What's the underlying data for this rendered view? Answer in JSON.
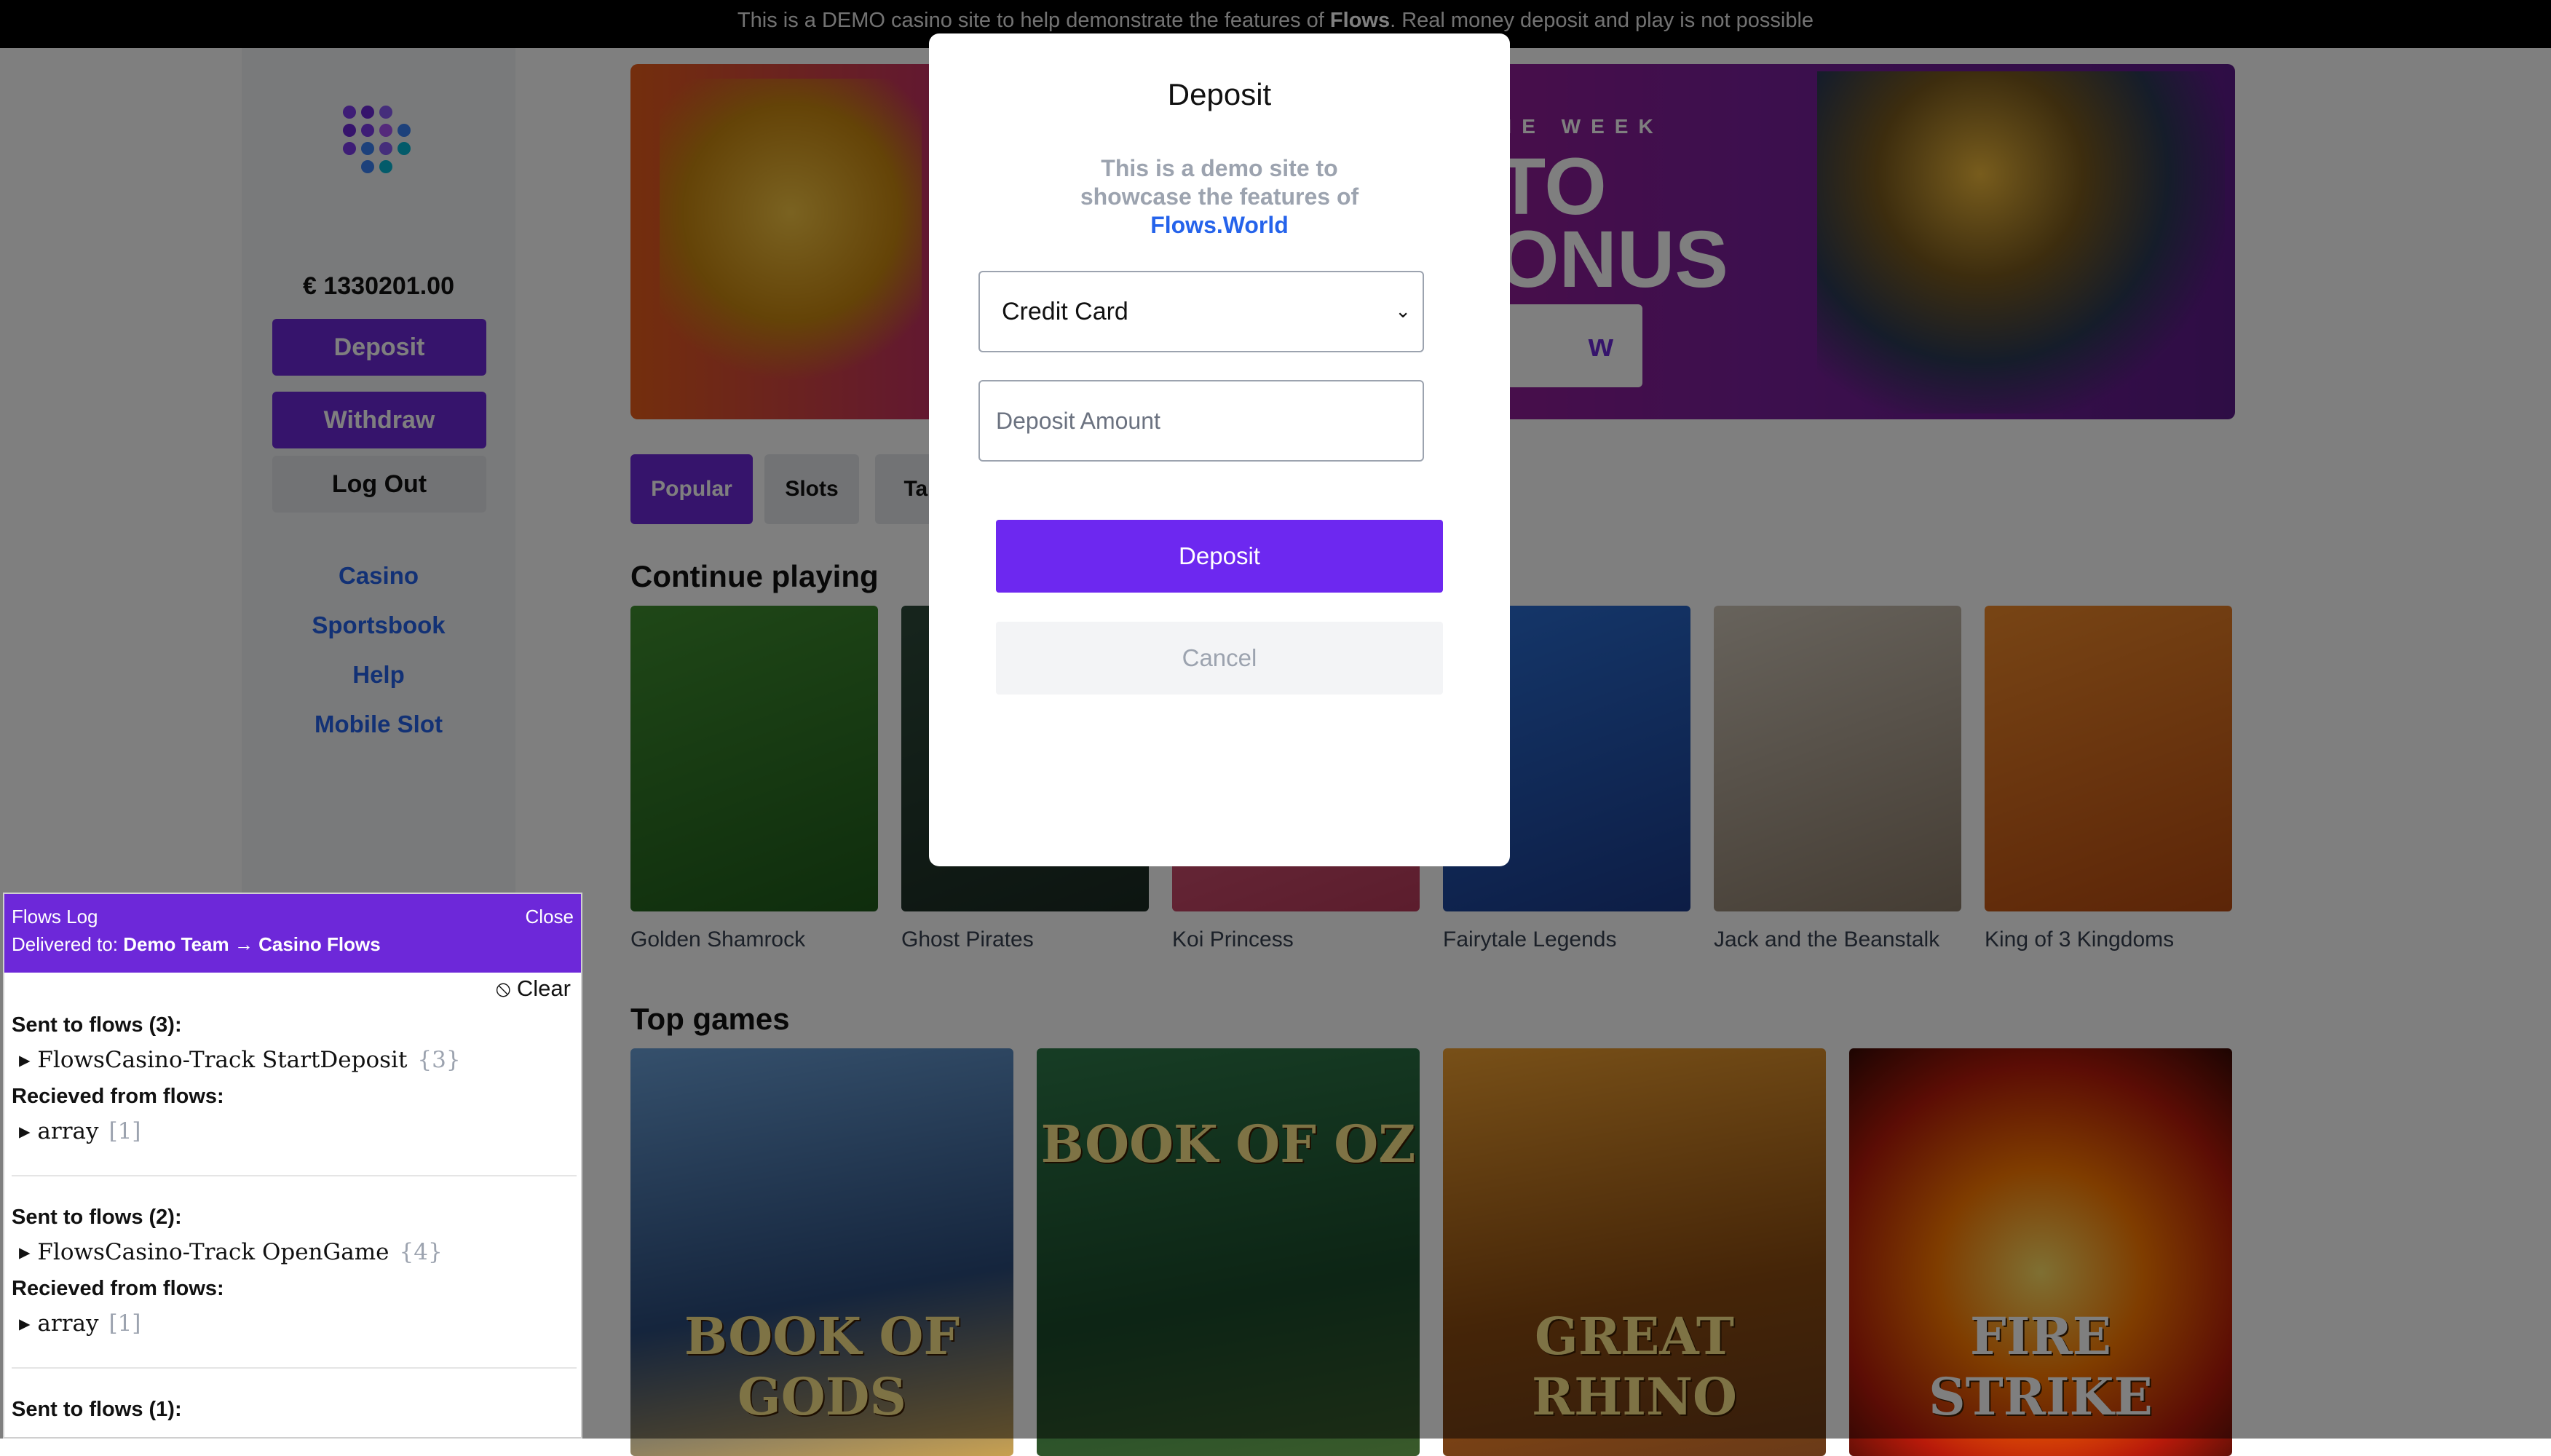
{
  "topbar": {
    "text_before": "This is a DEMO casino site to help demonstrate the features of ",
    "brand": "Flows",
    "text_after": ". Real money deposit and play is not possible"
  },
  "sidebar": {
    "balance": "€ 1330201.00",
    "deposit_label": "Deposit",
    "withdraw_label": "Withdraw",
    "logout_label": "Log Out",
    "nav": [
      "Casino",
      "Sportsbook",
      "Help",
      "Mobile Slot"
    ]
  },
  "banner": {
    "week_text": "HE WEEK",
    "line1": "TO",
    "line2": "ONUS",
    "cta": "w"
  },
  "tabs": [
    "Popular",
    "Slots",
    "Tab"
  ],
  "continue_playing": {
    "title": "Continue playing",
    "games": [
      "Golden Shamrock",
      "Ghost Pirates",
      "Koi Princess",
      "Fairytale Legends",
      "Jack and the Beanstalk",
      "King of 3 Kingdoms"
    ]
  },
  "top_games": {
    "title": "Top games",
    "games": [
      "BOOK OF GODS",
      "BOOK OF OZ",
      "GREAT RHINO",
      "FIRE STRIKE"
    ]
  },
  "modal": {
    "title": "Deposit",
    "desc_line1": "This is a demo site to",
    "desc_line2": "showcase the features of",
    "desc_brand": "Flows.World",
    "method_value": "Credit Card",
    "amount_placeholder": "Deposit Amount",
    "deposit_label": "Deposit",
    "cancel_label": "Cancel"
  },
  "log": {
    "title": "Flows Log",
    "close": "Close",
    "delivered_prefix": "Delivered to: ",
    "delivered_target": "Demo Team → Casino Flows",
    "clear": "Clear",
    "entries": [
      {
        "sent": "Sent to flows (3):",
        "item": "FlowsCasino-Track StartDeposit",
        "count": "{3}",
        "recv": "Recieved from flows:",
        "recv_item": "array",
        "recv_count": "[1]"
      },
      {
        "sent": "Sent to flows (2):",
        "item": "FlowsCasino-Track OpenGame",
        "count": "{4}",
        "recv": "Recieved from flows:",
        "recv_item": "array",
        "recv_count": "[1]"
      },
      {
        "sent": "Sent to flows (1):"
      }
    ]
  },
  "colors": {
    "accent": "#6d28d9",
    "link": "#2563eb",
    "overlay": "rgba(0,0,0,0.5)"
  }
}
